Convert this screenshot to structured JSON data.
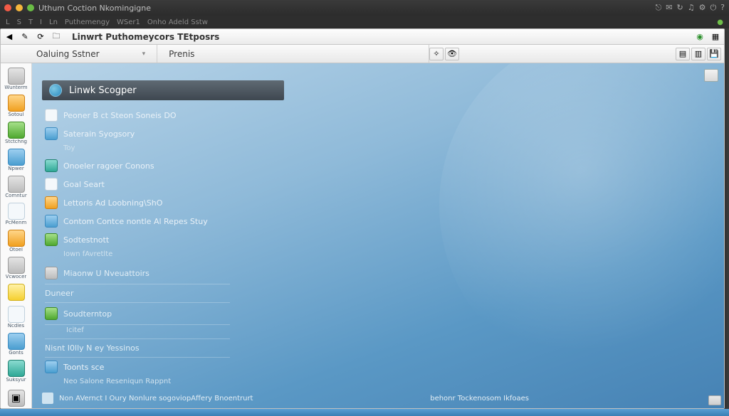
{
  "titlebar": {
    "title": "Uthum Coction Nkomingigne"
  },
  "menubar": {
    "items": [
      "L",
      "S",
      "T",
      "I",
      "Ln",
      "Puthemengy",
      "WSer1",
      "Onho Adeld Sstw"
    ]
  },
  "toolbar1": {
    "tab_label": "Linwrt Puthomeycors TEtposrs"
  },
  "toolbar2": {
    "crumb1": "Oaluing Sstner",
    "crumb2": "Prenis"
  },
  "sidebar": {
    "items": [
      {
        "label": "Wunterm",
        "color": "i-grey"
      },
      {
        "label": "Sotoul",
        "color": "i-orange"
      },
      {
        "label": "Stctchng",
        "color": "i-green"
      },
      {
        "label": "Npwer",
        "color": "i-blue"
      },
      {
        "label": "Comntur",
        "color": "i-grey"
      },
      {
        "label": "PcMenm",
        "color": "i-white"
      },
      {
        "label": "Otoel",
        "color": "i-orange"
      },
      {
        "label": "Vcwocer",
        "color": "i-grey"
      },
      {
        "label": "",
        "color": "i-yellow"
      },
      {
        "label": "Ncdles",
        "color": "i-white"
      },
      {
        "label": "Gonts",
        "color": "i-blue"
      },
      {
        "label": "Suksyur",
        "color": "i-teal"
      }
    ]
  },
  "panel": {
    "header": "Linwk Scogper",
    "rows": [
      {
        "label": "Peoner B ct Steon Soneis DO",
        "sub": "",
        "color": "i-white"
      },
      {
        "label": "Saterain Syogsory",
        "sub": "Toy",
        "color": "i-blue"
      },
      {
        "label": "Onoeler ragoer Conons",
        "sub": "",
        "color": "i-teal"
      },
      {
        "label": "Goal Seart",
        "sub": "",
        "color": "i-white"
      },
      {
        "label": "Lettoris Ad Loobning\\ShO",
        "sub": "",
        "color": "i-orange"
      },
      {
        "label": "Contom Contce nontle Al Repes Stuy",
        "sub": "",
        "color": "i-blue"
      },
      {
        "label": "Sodtestnott",
        "sub": "Iown fAvretlte",
        "color": "i-green"
      }
    ],
    "sep_rows": [
      {
        "label": "Miaonw U Nveuattoirs",
        "color": "i-grey"
      },
      {
        "label": "Duneer",
        "color": ""
      },
      {
        "label": "Soudterntop",
        "sub": "Icitef",
        "color": "i-green"
      },
      {
        "label": "Nisnt I0lly N ey Yessinos",
        "color": ""
      },
      {
        "label": "Toonts sce",
        "sub": "Neo Salone Reseniqun Rappnt",
        "color": "i-blue"
      }
    ]
  },
  "status": {
    "left": "Non AVernct I Oury Nonlure sogoviopAffery Bnoentrurt",
    "right": "behonr Tockenosom Ikfoaes"
  }
}
